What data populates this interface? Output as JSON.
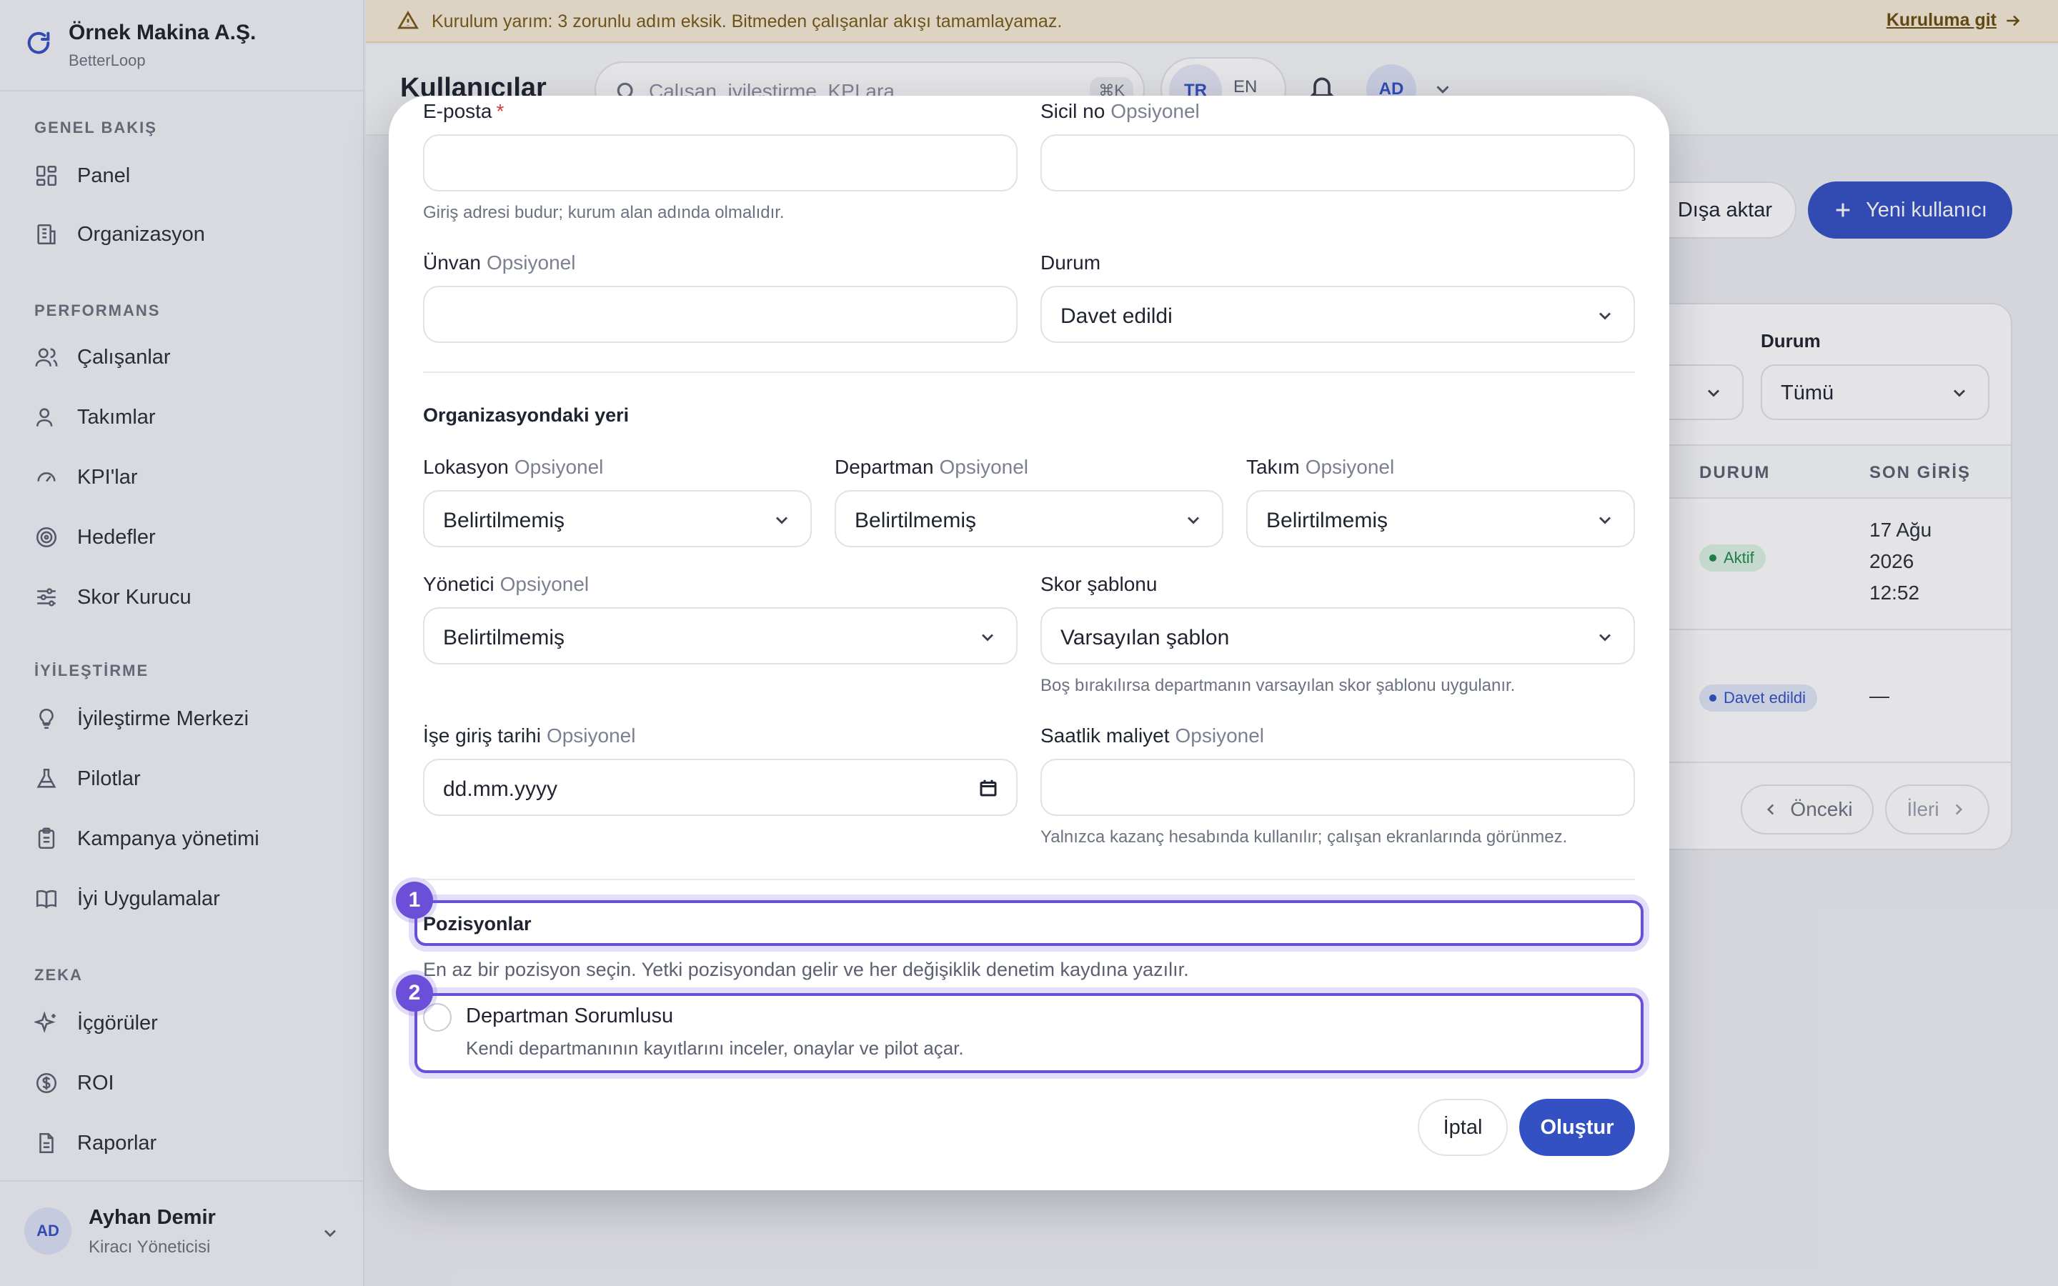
{
  "org": {
    "name": "Örnek Makina A.Ş.",
    "product": "BetterLoop"
  },
  "sidebar": {
    "sections": [
      {
        "title": "GENEL BAKIŞ",
        "items": [
          {
            "label": "Panel",
            "icon": "grid-icon"
          },
          {
            "label": "Organizasyon",
            "icon": "building-icon"
          }
        ]
      },
      {
        "title": "PERFORMANS",
        "items": [
          {
            "label": "Çalışanlar",
            "icon": "users-icon"
          },
          {
            "label": "Takımlar",
            "icon": "user-icon"
          },
          {
            "label": "KPI'lar",
            "icon": "gauge-icon"
          },
          {
            "label": "Hedefler",
            "icon": "target-icon"
          },
          {
            "label": "Skor Kurucu",
            "icon": "sliders-icon"
          }
        ]
      },
      {
        "title": "İYİLEŞTİRME",
        "items": [
          {
            "label": "İyileştirme Merkezi",
            "icon": "lightbulb-icon"
          },
          {
            "label": "Pilotlar",
            "icon": "flask-icon"
          },
          {
            "label": "Kampanya yönetimi",
            "icon": "clipboard-icon"
          },
          {
            "label": "İyi Uygulamalar",
            "icon": "book-icon"
          }
        ]
      },
      {
        "title": "ZEKA",
        "items": [
          {
            "label": "İçgörüler",
            "icon": "sparkles-icon"
          },
          {
            "label": "ROI",
            "icon": "dollar-icon"
          },
          {
            "label": "Raporlar",
            "icon": "file-icon"
          }
        ]
      }
    ],
    "profile": {
      "initials": "AD",
      "name": "Ayhan Demir",
      "role": "Kiracı Yöneticisi"
    }
  },
  "banner": {
    "text": "Kurulum yarım: 3 zorunlu adım eksik. Bitmeden çalışanlar akışı tamamlayamaz.",
    "link": "Kuruluma git"
  },
  "topbar": {
    "title": "Kullanıcılar",
    "search_placeholder": "Çalışan, iyileştirme, KPI ara...",
    "search_shortcut": "⌘K",
    "lang_active": "TR",
    "lang_other": "EN",
    "avatar_initials": "AD"
  },
  "page": {
    "export_label": "Dışa aktar",
    "new_user_label": "Yeni kullanıcı",
    "filter_status_label": "Durum",
    "filter_status_value": "Tümü",
    "columns": [
      "DURUM",
      "SON GİRİŞ"
    ],
    "rows": [
      {
        "status": "Aktif",
        "last_login": [
          "17 Ağu",
          "2026",
          "12:52"
        ]
      },
      {
        "status": "Davet edildi",
        "last_login": [
          "—"
        ]
      }
    ],
    "prev_label": "Önceki",
    "next_label": "İleri"
  },
  "modal": {
    "optional_tag": "Opsiyonel",
    "email": {
      "label": "E-posta",
      "required": "*",
      "value": "",
      "hint": "Giriş adresi budur; kurum alan adında olmalıdır."
    },
    "sicil": {
      "label": "Sicil no",
      "value": ""
    },
    "title_field": {
      "label": "Ünvan",
      "value": ""
    },
    "status": {
      "label": "Durum",
      "value": "Davet edildi"
    },
    "org_section_title": "Organizasyondaki yeri",
    "location": {
      "label": "Lokasyon",
      "value": "Belirtilmemiş"
    },
    "department": {
      "label": "Departman",
      "value": "Belirtilmemiş"
    },
    "team": {
      "label": "Takım",
      "value": "Belirtilmemiş"
    },
    "manager": {
      "label": "Yönetici",
      "value": "Belirtilmemiş"
    },
    "score_template": {
      "label": "Skor şablonu",
      "value": "Varsayılan şablon",
      "hint": "Boş bırakılırsa departmanın varsayılan skor şablonu uygulanır."
    },
    "start_date": {
      "label": "İşe giriş tarihi",
      "value": "dd.mm.yyyy"
    },
    "hourly_cost": {
      "label": "Saatlik maliyet",
      "value": "",
      "hint": "Yalnızca kazanç hesabında kullanılır; çalışan ekranlarında görünmez."
    },
    "positions": {
      "step": "1",
      "title": "Pozisyonlar",
      "hint": "En az bir pozisyon seçin. Yetki pozisyondan gelir ve her değişiklik denetim kaydına yazılır.",
      "option_step": "2",
      "option": {
        "title": "Departman Sorumlusu",
        "description": "Kendi departmanının kayıtlarını inceler, onaylar ve pilot açar.",
        "selected": false
      }
    },
    "cancel_label": "İptal",
    "create_label": "Oluştur"
  },
  "colors": {
    "primary": "#3451c4",
    "step_highlight": "#6b4fd8",
    "banner_bg": "#f6ecd8",
    "banner_text": "#7a5a16",
    "active_green": "#1f8a4c"
  }
}
